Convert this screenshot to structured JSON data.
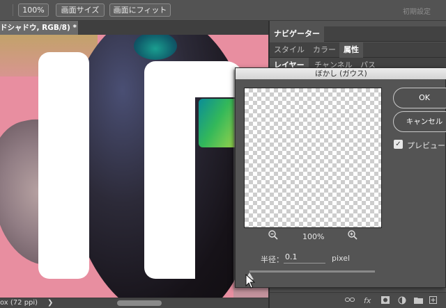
{
  "options_bar": {
    "zoom_100": "100%",
    "fit_screen": "画面サイズ",
    "fill_screen": "画面にフィット",
    "reset": "初期設定"
  },
  "document": {
    "tab_title": "ドシャドウ, RGB/8) *"
  },
  "status_bar": {
    "info": "ox (72 ppi)",
    "arrow": "❯"
  },
  "panels": {
    "row1": [
      "ナビゲーター"
    ],
    "row2": [
      "スタイル",
      "カラー",
      "属性"
    ],
    "row3": [
      "レイヤー",
      "チャンネル",
      "パス"
    ]
  },
  "dialog": {
    "title": "ぼかし (ガウス)",
    "ok_label": "OK",
    "cancel_label": "キャンセル",
    "preview_label": "プレビュー",
    "preview_checked": true,
    "zoom_level": "100%",
    "radius_label": "半径：",
    "radius_value": "0.1",
    "radius_unit": "pixel",
    "slider_value": 0.1
  },
  "panel_icons": [
    "link-icon",
    "fx-icon",
    "mask-icon",
    "adjustment-icon",
    "folder-icon",
    "new-layer-icon",
    "trash-icon"
  ]
}
